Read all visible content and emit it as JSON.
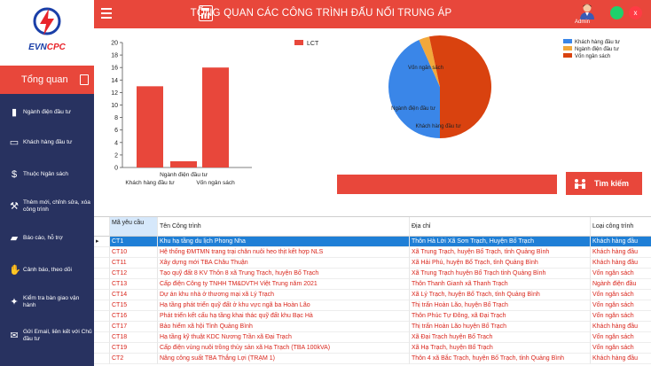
{
  "app": {
    "logo_text_a": "EVN",
    "logo_text_b": "CPC",
    "title": "TỔNG QUAN CÁC CÔNG TRÌNH ĐẤU NỐI TRUNG ÁP",
    "admin_label": "Admin",
    "close_label": "x"
  },
  "sidebar": {
    "overview_label": "Tổng quan",
    "items": [
      {
        "label": "Ngành điện đầu tư",
        "icon": "book-icon"
      },
      {
        "label": "Khách hàng đầu tư",
        "icon": "id-card-icon"
      },
      {
        "label": "Thuộc Ngân sách",
        "icon": "money-icon"
      },
      {
        "label": "Thêm mới, chỉnh sửa, xóa công trình",
        "icon": "hammer-icon"
      },
      {
        "label": "Báo cáo, hỗ trợ",
        "icon": "car-icon"
      },
      {
        "label": "Cảnh báo, theo dõi",
        "icon": "hand-icon"
      },
      {
        "label": "Kiểm tra bàn giao vận hành",
        "icon": "handshake-icon"
      },
      {
        "label": "Gửi Email, liên kết với Chủ đầu tư",
        "icon": "email-icon"
      }
    ]
  },
  "search": {
    "value": "",
    "button_label": "Tìm kiếm"
  },
  "colors": {
    "accent": "#e8473b",
    "sidebar": "#283260",
    "pie_customer": "#3a86e8",
    "pie_utility": "#f2a83b",
    "pie_budget": "#d9420f"
  },
  "bar_chart_data": {
    "type": "bar",
    "legend": "LCT",
    "categories": [
      "Khách hàng đầu tư",
      "Ngành điện đầu tư",
      "Vốn ngân sách"
    ],
    "values": [
      13,
      1,
      16
    ],
    "ylim": [
      0,
      20
    ],
    "yticks": [
      "0",
      "2",
      "4",
      "6",
      "8",
      "10",
      "12",
      "14",
      "16",
      "18",
      "20"
    ]
  },
  "chart_data": {
    "type": "pie",
    "categories": [
      "Khách hàng đầu tư",
      "Ngành điện đầu tư",
      "Vốn ngân sách"
    ],
    "values": [
      13,
      1,
      16
    ],
    "legend_position": "top-right"
  },
  "table": {
    "headers": [
      "Mã yêu cầu",
      "Tên Công trình",
      "Địa chỉ",
      "Loại công trình"
    ],
    "rows": [
      {
        "code": "CT1",
        "name": "Khu hạ tầng du lịch Phong Nha",
        "address": "Thôn Hà Lời Xã Sơn Trạch, Huyện Bố Trạch",
        "type": "Khách hàng đầu"
      },
      {
        "code": "CT10",
        "name": "Hệ thống ĐMTMN trang trại chăn nuôi heo thịt kết hợp NLS",
        "address": "Xã Trung Trạch, huyện Bố Trạch, tỉnh Quảng Bình",
        "type": "Khách hàng đầu"
      },
      {
        "code": "CT11",
        "name": "Xây dựng mới TBA Châu Thuận",
        "address": "Xã Hải Phú, huyện Bố Trạch, tỉnh Quảng Bình",
        "type": "Khách hàng đầu"
      },
      {
        "code": "CT12",
        "name": "Tạo quỹ đất 8 KV Thôn 8 xã Trung Trạch, huyện Bố Trạch",
        "address": "Xã Trung Trạch huyện Bố Trạch tỉnh Quảng Bình",
        "type": "Vốn ngân sách"
      },
      {
        "code": "CT13",
        "name": "Cấp điện Công ty TNHH TM&DVTH Việt Trung năm 2021",
        "address": "Thôn Thanh Gianh xã Thanh Trạch",
        "type": "Ngành điện đầu"
      },
      {
        "code": "CT14",
        "name": "Dự án khu nhà ở thương mại xã Lý Trạch",
        "address": "Xã Lý Trạch, huyện Bố Trạch, tỉnh Quảng Bình",
        "type": "Vốn ngân sách"
      },
      {
        "code": "CT15",
        "name": "Hạ tầng phát triển quỹ đất ở khu vực ngã ba Hoàn Lão",
        "address": "Thị trấn Hoàn Lão, huyện Bố Trạch",
        "type": "Vốn ngân sách"
      },
      {
        "code": "CT16",
        "name": "Phát triển kết cấu hạ tầng khai thác quỹ đất khu Bạc Hà",
        "address": "Thôn Phúc Tự Đông, xã Đại Trạch",
        "type": "Vốn ngân sách"
      },
      {
        "code": "CT17",
        "name": "Bảo hiểm xã hội Tỉnh Quảng Bình",
        "address": "Thị trấn Hoàn Lão huyện Bố Trạch",
        "type": "Khách hàng đầu"
      },
      {
        "code": "CT18",
        "name": "Hạ tầng kỹ thuật KDC Nương Trần xã Đại Trạch",
        "address": "Xã Đại Trạch huyện Bố Trạch",
        "type": "Vốn ngân sách"
      },
      {
        "code": "CT19",
        "name": "Cấp điện vùng nuôi trồng thủy sản xã Hạ Trạch (TBA 100kVA)",
        "address": "Xã Hạ Trạch, huyện Bố Trạch",
        "type": "Vốn ngân sách"
      },
      {
        "code": "CT2",
        "name": "Nâng công suất TBA Thắng Lợi (TRẠM 1)",
        "address": "Thôn 4 xã Bắc Trạch, huyện Bố Trạch, tỉnh Quảng Bình",
        "type": "Khách hàng đầu"
      }
    ]
  }
}
